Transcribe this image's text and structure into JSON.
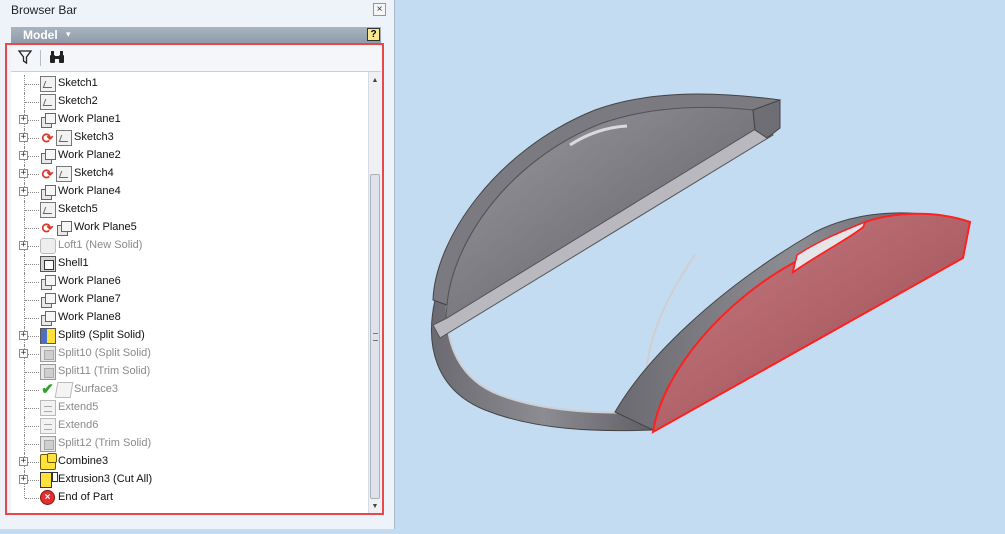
{
  "window": {
    "title": "Browser Bar",
    "close_symbol": "×"
  },
  "browser": {
    "model_label": "Model",
    "model_arrow": "▾",
    "help_symbol": "?",
    "toolbar": {
      "filter_icon": "filter-icon",
      "find_icon": "binoculars-icon"
    },
    "tree": [
      {
        "label": "Sketch1",
        "icon": "sketch-icon",
        "expander": "",
        "dim": false,
        "status": ""
      },
      {
        "label": "Sketch2",
        "icon": "sketch-icon",
        "expander": "",
        "dim": false,
        "status": ""
      },
      {
        "label": "Work Plane1",
        "icon": "work-plane-icon",
        "expander": "+",
        "dim": false,
        "status": ""
      },
      {
        "label": "Sketch3",
        "icon": "sketch-icon",
        "expander": "+",
        "dim": false,
        "status": "rebuild"
      },
      {
        "label": "Work Plane2",
        "icon": "work-plane-icon",
        "expander": "+",
        "dim": false,
        "status": ""
      },
      {
        "label": "Sketch4",
        "icon": "sketch-icon",
        "expander": "+",
        "dim": false,
        "status": "rebuild"
      },
      {
        "label": "Work Plane4",
        "icon": "work-plane-icon",
        "expander": "+",
        "dim": false,
        "status": ""
      },
      {
        "label": "Sketch5",
        "icon": "sketch-icon",
        "expander": "",
        "dim": false,
        "status": ""
      },
      {
        "label": "Work Plane5",
        "icon": "work-plane-icon",
        "expander": "",
        "dim": false,
        "status": "rebuild"
      },
      {
        "label": "Loft1 (New Solid)",
        "icon": "loft-icon",
        "expander": "+",
        "dim": true,
        "status": ""
      },
      {
        "label": "Shell1",
        "icon": "shell-icon",
        "expander": "",
        "dim": false,
        "status": ""
      },
      {
        "label": "Work Plane6",
        "icon": "work-plane-icon",
        "expander": "",
        "dim": false,
        "status": ""
      },
      {
        "label": "Work Plane7",
        "icon": "work-plane-icon",
        "expander": "",
        "dim": false,
        "status": ""
      },
      {
        "label": "Work Plane8",
        "icon": "work-plane-icon",
        "expander": "",
        "dim": false,
        "status": ""
      },
      {
        "label": "Split9 (Split Solid)",
        "icon": "split-solid-icon",
        "expander": "+",
        "dim": false,
        "status": ""
      },
      {
        "label": "Split10 (Split Solid)",
        "icon": "split-icon",
        "expander": "+",
        "dim": true,
        "status": ""
      },
      {
        "label": "Split11 (Trim Solid)",
        "icon": "split-icon",
        "expander": "",
        "dim": true,
        "status": ""
      },
      {
        "label": "Surface3",
        "icon": "surface-icon",
        "expander": "",
        "dim": true,
        "status": "check"
      },
      {
        "label": "Extend5",
        "icon": "extend-icon",
        "expander": "",
        "dim": true,
        "status": ""
      },
      {
        "label": "Extend6",
        "icon": "extend-icon",
        "expander": "",
        "dim": true,
        "status": ""
      },
      {
        "label": "Split12 (Trim Solid)",
        "icon": "split-icon",
        "expander": "",
        "dim": true,
        "status": ""
      },
      {
        "label": "Combine3",
        "icon": "combine-icon",
        "expander": "+",
        "dim": false,
        "status": ""
      },
      {
        "label": "Extrusion3 (Cut All)",
        "icon": "extrusion-icon",
        "expander": "+",
        "dim": false,
        "status": ""
      },
      {
        "label": "End of Part",
        "icon": "end-of-part-icon",
        "expander": "",
        "dim": false,
        "status": ""
      }
    ]
  },
  "viewport": {
    "background_color": "#c4dcf2",
    "body_color": "#8f8f95",
    "highlight_face_color": "#b15a62",
    "highlight_edge_color": "#ff2020"
  }
}
